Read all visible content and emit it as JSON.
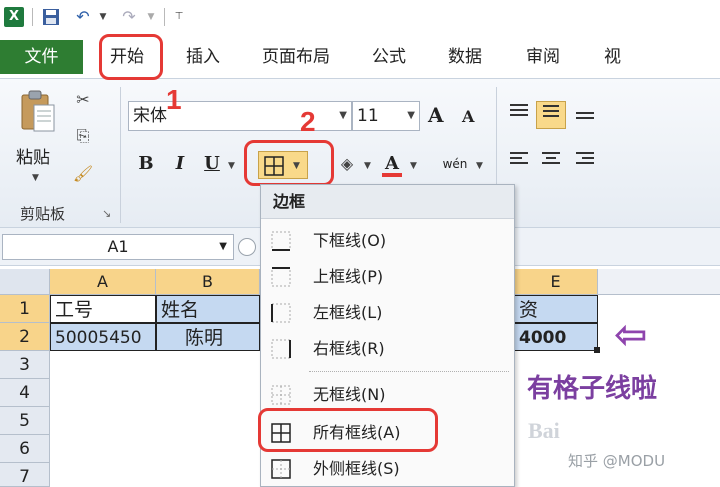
{
  "tabs": {
    "file": "文件",
    "home": "开始",
    "insert": "插入",
    "layout": "页面布局",
    "formulas": "公式",
    "data": "数据",
    "review": "审阅",
    "view": "视"
  },
  "ribbon": {
    "paste_label": "粘贴",
    "clipboard_label": "剪贴板",
    "font_name": "宋体",
    "font_size": "11",
    "bold": "B",
    "italic": "I",
    "underline": "U",
    "grow_font": "A",
    "shrink_font": "A",
    "font_color": "A",
    "phonetic": "wén"
  },
  "annotations": {
    "step1": "1",
    "step2": "2",
    "result_text": "有格子线啦",
    "arrow": "⇦",
    "watermark": "知乎 @MODU",
    "bai": "Bai"
  },
  "formula_bar": {
    "name_box": "A1"
  },
  "grid": {
    "columns": [
      "A",
      "B",
      "E"
    ],
    "rows": [
      "1",
      "2",
      "3",
      "4",
      "5",
      "6",
      "7"
    ],
    "cells": {
      "A1": "工号",
      "B1": "姓名",
      "E1": "资",
      "A2": "50005450",
      "B2": "陈明",
      "E2": "4000"
    }
  },
  "border_menu": {
    "title": "边框",
    "items": [
      {
        "label": "下框线(O)"
      },
      {
        "label": "上框线(P)"
      },
      {
        "label": "左框线(L)"
      },
      {
        "label": "右框线(R)"
      },
      {
        "label": "无框线(N)"
      },
      {
        "label": "所有框线(A)"
      },
      {
        "label": "外侧框线(S)"
      }
    ]
  },
  "colors": {
    "accent_red": "#e53935",
    "file_tab": "#2e7d32",
    "selection": "#c5d9f1",
    "annotation_purple": "#7b3fa0"
  }
}
